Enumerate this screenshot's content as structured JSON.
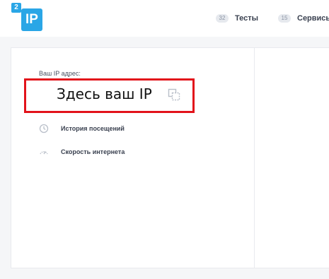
{
  "logo": {
    "badge": "2",
    "text": "IP"
  },
  "nav": [
    {
      "count": "32",
      "label": "Тесты"
    },
    {
      "count": "15",
      "label": "Сервисы"
    }
  ],
  "ip_section": {
    "label": "Ваш IP адрес:",
    "value": "Здесь ваш IP"
  },
  "menu": [
    {
      "label": "История посещений",
      "icon": "history-icon"
    },
    {
      "label": "Скорость интернета",
      "icon": "speedometer-icon"
    }
  ],
  "colors": {
    "brand": "#2aa6e6",
    "highlight_border": "#e2131b",
    "text_dark": "#3a4150",
    "icon_gray": "#b9bfc9"
  }
}
